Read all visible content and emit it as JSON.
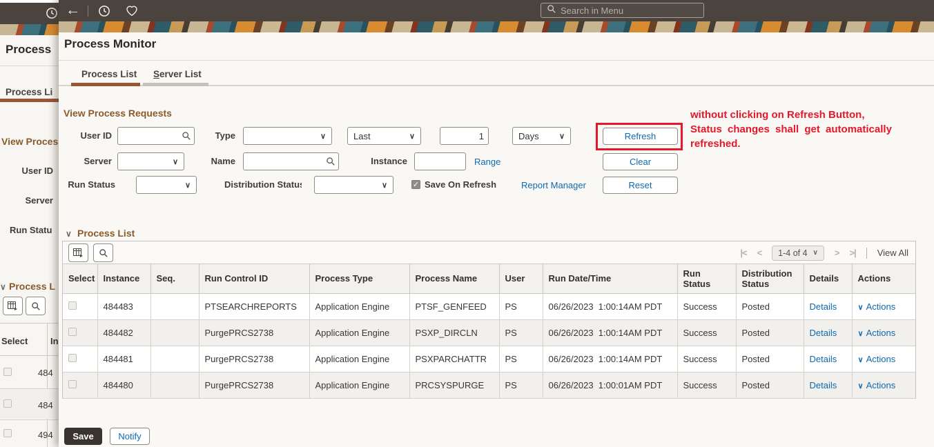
{
  "colors": {
    "topbar_bg": "#4b443e",
    "accent_brown": "#9a5632",
    "link_blue": "#0f69af",
    "annotation_red": "#e4182a"
  },
  "topbar": {
    "search_placeholder": "Search in Menu"
  },
  "page": {
    "title": "Process Monitor",
    "tabs": [
      {
        "label": "Process List"
      },
      {
        "label": "Server List"
      }
    ]
  },
  "filters": {
    "section_title": "View Process Requests",
    "user_id_label": "User ID",
    "type_label": "Type",
    "last_value": "Last",
    "days_value": "1",
    "days_unit_value": "Days",
    "server_label": "Server",
    "name_label": "Name",
    "instance_label": "Instance",
    "range_link": "Range",
    "run_status_label": "Run Status",
    "distribution_status_label": "Distribution Status",
    "save_on_refresh_label": "Save On Refresh",
    "report_manager_link": "Report Manager",
    "refresh_button": "Refresh",
    "clear_button": "Clear",
    "reset_button": "Reset"
  },
  "annotation": {
    "line1": "without clicking on Refresh Button,",
    "line2": "Status changes shall get automatically",
    "line3": "refreshed."
  },
  "process_list": {
    "section_title": "Process List",
    "pagination": {
      "range": "1-4 of 4",
      "view_all": "View All"
    },
    "columns": [
      "Select",
      "Instance",
      "Seq.",
      "Run Control ID",
      "Process Type",
      "Process Name",
      "User",
      "Run Date/Time",
      "Run Status",
      "Distribution Status",
      "Details",
      "Actions"
    ],
    "rows": [
      {
        "instance": "484483",
        "seq": "",
        "run_control_id": "PTSEARCHREPORTS",
        "process_type": "Application Engine",
        "process_name": "PTSF_GENFEED",
        "user": "PS",
        "run_datetime": "06/26/2023  1:00:14AM PDT",
        "run_status": "Success",
        "distribution_status": "Posted",
        "details_link": "Details",
        "actions_link": "Actions"
      },
      {
        "instance": "484482",
        "seq": "",
        "run_control_id": "PurgePRCS2738",
        "process_type": "Application Engine",
        "process_name": "PSXP_DIRCLN",
        "user": "PS",
        "run_datetime": "06/26/2023  1:00:14AM PDT",
        "run_status": "Success",
        "distribution_status": "Posted",
        "details_link": "Details",
        "actions_link": "Actions"
      },
      {
        "instance": "484481",
        "seq": "",
        "run_control_id": "PurgePRCS2738",
        "process_type": "Application Engine",
        "process_name": "PSXPARCHATTR",
        "user": "PS",
        "run_datetime": "06/26/2023  1:00:14AM PDT",
        "run_status": "Success",
        "distribution_status": "Posted",
        "details_link": "Details",
        "actions_link": "Actions"
      },
      {
        "instance": "484480",
        "seq": "",
        "run_control_id": "PurgePRCS2738",
        "process_type": "Application Engine",
        "process_name": "PRCSYSPURGE",
        "user": "PS",
        "run_datetime": "06/26/2023  1:00:01AM PDT",
        "run_status": "Success",
        "distribution_status": "Posted",
        "details_link": "Details",
        "actions_link": "Actions"
      }
    ]
  },
  "footer": {
    "save_button": "Save",
    "notify_button": "Notify"
  },
  "background_page": {
    "title": "Process",
    "tab": "Process Li",
    "section_title": "View Proces",
    "user_id_label": "User ID",
    "server_label": "Server",
    "run_status_label": "Run Statu",
    "grid_section_title": "Process L",
    "col_select": "Select",
    "col_instance": "Ins",
    "rows": [
      "484",
      "484",
      "494"
    ]
  }
}
